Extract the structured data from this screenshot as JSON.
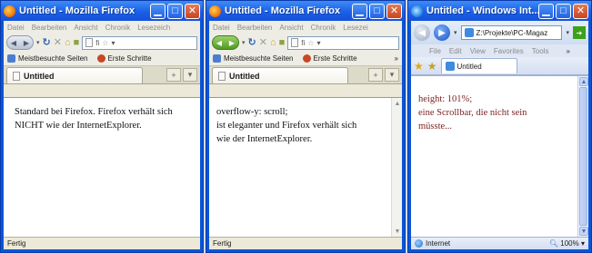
{
  "window1": {
    "title": "Untitled - Mozilla Firefox",
    "menus": [
      "Datei",
      "Bearbeiten",
      "Ansicht",
      "Chronik",
      "Lesezeich"
    ],
    "url": "fi",
    "bookmarks": [
      "Meistbesuchte Seiten",
      "Erste Schritte"
    ],
    "tab_title": "Untitled",
    "content_lines": [
      "Standard bei Firefox. Firefox verhält sich",
      "NICHT wie der InternetExplorer."
    ],
    "status": "Fertig"
  },
  "window2": {
    "title": "Untitled - Mozilla Firefox",
    "menus": [
      "Datei",
      "Bearbeiten",
      "Ansicht",
      "Chronik",
      "Lesezei"
    ],
    "url": "fi",
    "bookmarks": [
      "Meistbesuchte Seiten",
      "Erste Schritte"
    ],
    "overflow_glyph": "»",
    "tab_title": "Untitled",
    "content_lines": [
      "overflow-y: scroll;",
      "ist eleganter und Firefox verhält sich",
      "wie der InternetExplorer."
    ],
    "status": "Fertig"
  },
  "window3": {
    "title": "Untitled - Windows Int...",
    "address": "Z:\\Projekte\\PC-Magaz",
    "menus": [
      "File",
      "Edit",
      "View",
      "Favorites",
      "Tools"
    ],
    "overflow_glyph": "»",
    "tab_title": "Untitled",
    "content_lines": [
      "height: 101%;",
      "eine Scrollbar, die nicht sein",
      "müsste..."
    ],
    "status_left": "Internet",
    "zoom": "100%"
  },
  "icons": {
    "minimize": "minimize-icon",
    "maximize": "maximize-icon",
    "close": "close-icon",
    "reload": "reload-icon",
    "stop": "stop-icon",
    "home": "home-icon",
    "star": "star-icon"
  },
  "colors": {
    "titlebar": "#1b5fe8",
    "frame": "#0a55d8",
    "chrome": "#ece9d8",
    "ie_text": "#7a1f1f"
  }
}
